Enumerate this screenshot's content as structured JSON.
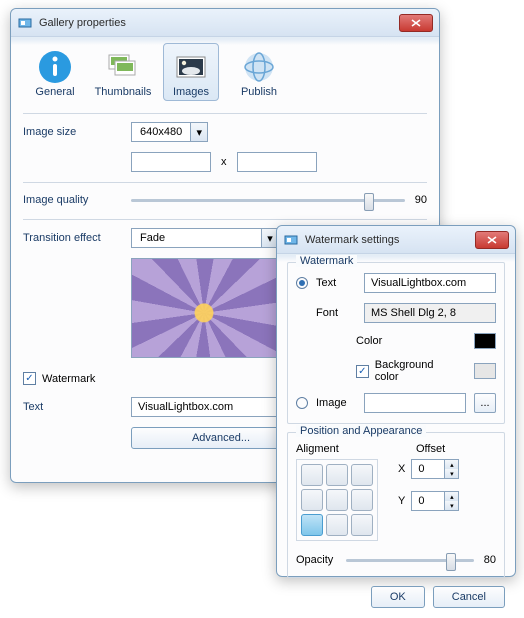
{
  "win1": {
    "title": "Gallery properties",
    "tabs": {
      "general": "General",
      "thumbnails": "Thumbnails",
      "images": "Images",
      "publish": "Publish"
    },
    "labels": {
      "imageSize": "Image size",
      "x": "x",
      "imageQuality": "Image quality",
      "transition": "Transition effect",
      "watermark": "Watermark",
      "text": "Text"
    },
    "imageSize": "640x480",
    "quality": "90",
    "transitionEffect": "Fade",
    "watermarkChecked": "✓",
    "text": "VisualLightbox.com",
    "advanced": "Advanced..."
  },
  "win2": {
    "title": "Watermark settings",
    "groups": {
      "watermark": "Watermark",
      "position": "Position and Appearance"
    },
    "labels": {
      "text": "Text",
      "font": "Font",
      "color": "Color",
      "bgcolor": "Background color",
      "image": "Image",
      "alignment": "Aligment",
      "offset": "Offset",
      "x": "X",
      "y": "Y",
      "opacity": "Opacity"
    },
    "text": "VisualLightbox.com",
    "font": "MS Shell Dlg 2, 8",
    "colorHex": "#000000",
    "bgChecked": "✓",
    "bgColorHex": "#e6e6e6",
    "browse": "...",
    "offsetX": "0",
    "offsetY": "0",
    "opacity": "80",
    "ok": "OK",
    "cancel": "Cancel"
  }
}
